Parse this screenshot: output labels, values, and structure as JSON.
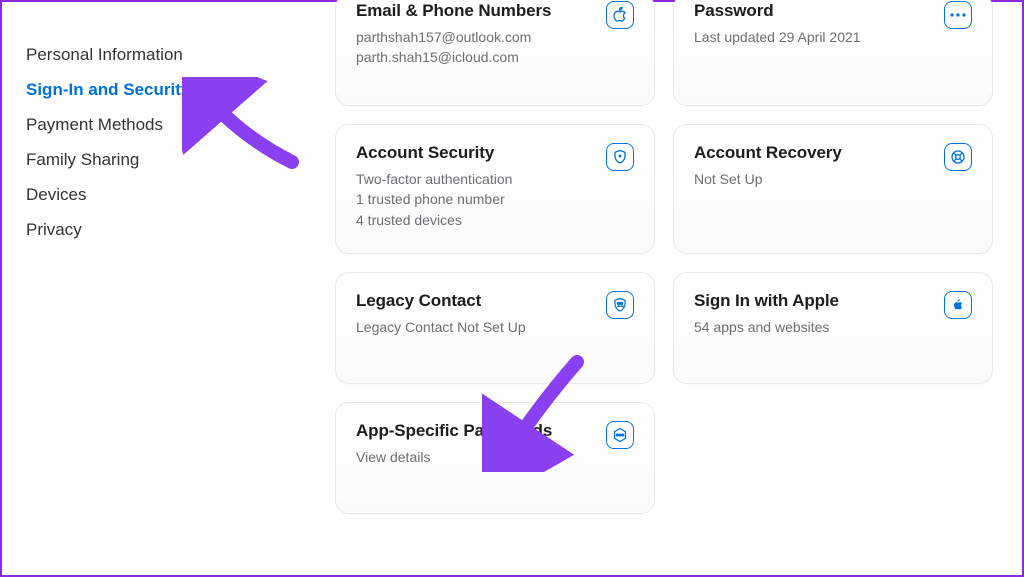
{
  "sidebar": {
    "items": [
      {
        "label": "Personal Information",
        "active": false
      },
      {
        "label": "Sign-In and Security",
        "active": true
      },
      {
        "label": "Payment Methods",
        "active": false
      },
      {
        "label": "Family Sharing",
        "active": false
      },
      {
        "label": "Devices",
        "active": false
      },
      {
        "label": "Privacy",
        "active": false
      }
    ]
  },
  "cards": {
    "email_phone": {
      "title": "Email & Phone Numbers",
      "lines": [
        "parthshah157@outlook.com",
        "parth.shah15@icloud.com"
      ],
      "icon": "apple-icon"
    },
    "password": {
      "title": "Password",
      "lines": [
        "Last updated 29 April 2021"
      ],
      "icon": "dots-icon"
    },
    "account_security": {
      "title": "Account Security",
      "lines": [
        "Two-factor authentication",
        "1 trusted phone number",
        "4 trusted devices"
      ],
      "icon": "shield-icon"
    },
    "account_recovery": {
      "title": "Account Recovery",
      "lines": [
        "Not Set Up"
      ],
      "icon": "lifebuoy-icon"
    },
    "legacy_contact": {
      "title": "Legacy Contact",
      "lines": [
        "Legacy Contact Not Set Up"
      ],
      "icon": "people-shield-icon"
    },
    "sign_in_apple": {
      "title": "Sign In with Apple",
      "lines": [
        "54 apps and websites"
      ],
      "icon": "apple-square-icon"
    },
    "app_specific": {
      "title": "App-Specific Passwords",
      "lines": [
        "View details"
      ],
      "icon": "dots-hex-icon"
    }
  }
}
